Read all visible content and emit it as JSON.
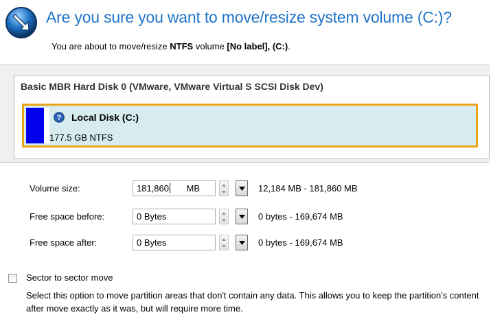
{
  "header": {
    "title": "Are you sure you want to move/resize system volume (C:)?",
    "subtitle_prefix": "You are about to move/resize",
    "subtitle_fs": "NTFS",
    "subtitle_mid": "volume",
    "subtitle_label": "[No label], (C:)",
    "subtitle_suffix": ".",
    "icon": "wizard-arrow-icon"
  },
  "disk": {
    "name": "Basic MBR Hard Disk 0 (VMware, VMware Virtual S SCSI Disk Dev)",
    "partition": {
      "label": "Local Disk (C:)",
      "size": "177.5 GB NTFS",
      "used_fraction": 0.07,
      "icon": "help-icon"
    }
  },
  "fields": {
    "volume_size": {
      "label": "Volume size:",
      "value": "181,860",
      "unit": "MB",
      "range": "12,184 MB - 181,860 MB"
    },
    "free_before": {
      "label": "Free space before:",
      "value": "0 Bytes",
      "range": "0 bytes - 169,674 MB"
    },
    "free_after": {
      "label": "Free space after:",
      "value": "0 Bytes",
      "range": "0 bytes - 169,674 MB"
    }
  },
  "sector_move": {
    "label": "Sector to sector move",
    "checked": false,
    "description": "Select this option to move partition areas that don't contain any data. This allows you to keep the partition's content after move exactly as it was, but will require more time."
  },
  "colors": {
    "title": "#1f74c9",
    "selection_border": "#e9a418",
    "partition_fill": "#d6ecee",
    "usage": "#0000ee"
  }
}
